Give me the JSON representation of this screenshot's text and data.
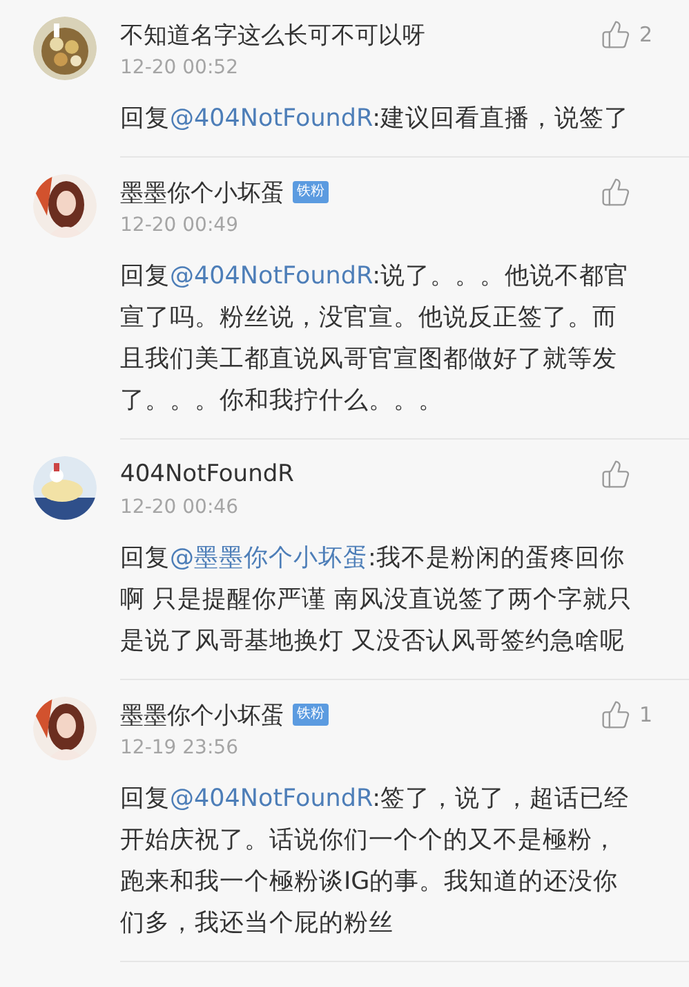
{
  "comments": [
    {
      "name": "不知道名字这么长可不可以呀",
      "time": "12-20 00:52",
      "likes": "2",
      "reply_prefix": "回复",
      "mention": "@404NotFoundR",
      "text": ":建议回看直播，说签了"
    },
    {
      "name": "墨墨你个小坏蛋",
      "badge": "铁粉",
      "time": "12-20 00:49",
      "reply_prefix": "回复",
      "mention": "@404NotFoundR",
      "text": ":说了。。。他说不都官宣了吗。粉丝说，没官宣。他说反正签了。而且我们美工都直说风哥官宣图都做好了就等发了。。。你和我拧什么。。。"
    },
    {
      "name": "404NotFoundR",
      "time": "12-20 00:46",
      "reply_prefix": "回复",
      "mention": "@墨墨你个小坏蛋",
      "text": ":我不是粉闲的蛋疼回你啊 只是提醒你严谨 南风没直说签了两个字就只是说了风哥基地换灯 又没否认风哥签约急啥呢"
    },
    {
      "name": "墨墨你个小坏蛋",
      "badge": "铁粉",
      "time": "12-19 23:56",
      "likes": "1",
      "reply_prefix": "回复",
      "mention": "@404NotFoundR",
      "text": ":签了，说了，超话已经开始庆祝了。话说你们一个个的又不是極粉，跑来和我一个極粉谈IG的事。我知道的还没你们多，我还当个屁的粉丝"
    }
  ]
}
